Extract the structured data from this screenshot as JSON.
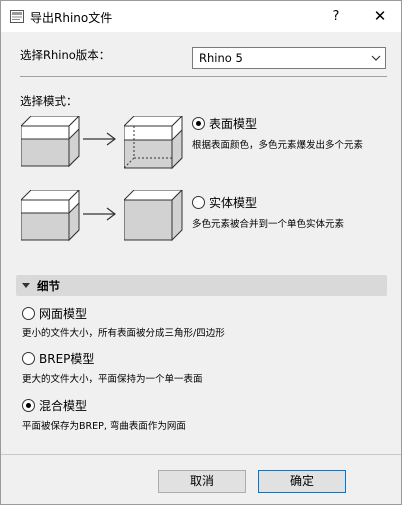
{
  "window": {
    "title": "导出Rhino文件",
    "help": "?",
    "close": "✕"
  },
  "version": {
    "label": "选择Rhino版本：",
    "selected": "Rhino 5"
  },
  "mode": {
    "label": "选择模式：",
    "options": [
      {
        "label": "表面模型",
        "desc": "根据表面颜色，多色元素爆发出多个元素",
        "checked": true
      },
      {
        "label": "实体模型",
        "desc": "多色元素被合并到一个单色实体元素",
        "checked": false
      }
    ]
  },
  "details": {
    "title": "细节",
    "options": [
      {
        "label": "网面模型",
        "desc": "更小的文件大小，所有表面被分成三角形/四边形",
        "checked": false
      },
      {
        "label": "BREP模型",
        "desc": "更大的文件大小，平面保持为一个单一表面",
        "checked": false
      },
      {
        "label": "混合模型",
        "desc": "平面被保存为BREP, 弯曲表面作为网面",
        "checked": true
      }
    ]
  },
  "buttons": {
    "cancel": "取消",
    "ok": "确定"
  }
}
